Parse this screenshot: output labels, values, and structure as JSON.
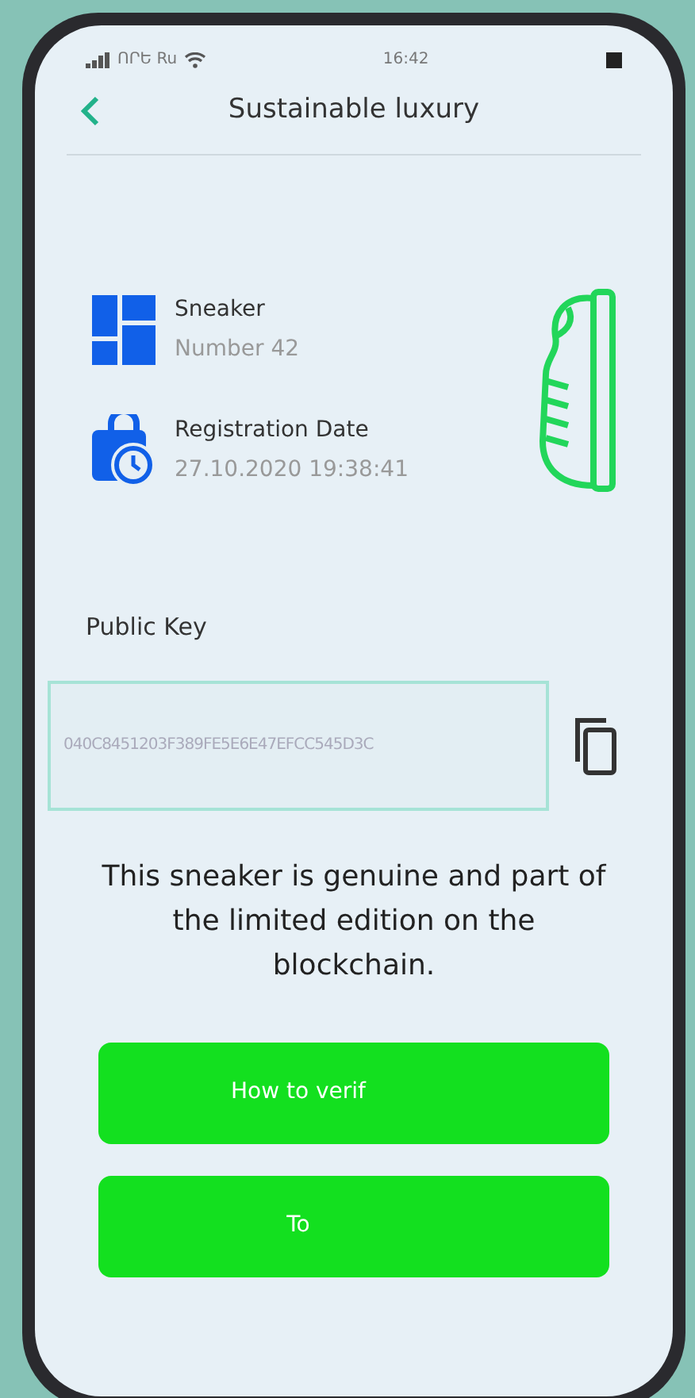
{
  "status_bar": {
    "carrier": "ՈՐԵ Ru",
    "time": "16:42"
  },
  "header": {
    "title": "Sustainable luxury"
  },
  "details": [
    {
      "kind": "product",
      "label": "Sneaker",
      "value": "Number 42"
    },
    {
      "kind": "date",
      "label": "Registration Date",
      "value": "27.10.2020 19:38:41"
    }
  ],
  "public_key": {
    "label": "Public Key",
    "value": "040C8451203F389FE5E6E47EFCC545D3C"
  },
  "message": "This sneaker is genuine and part of the limited edition on the blockchain.",
  "buttons": [
    {
      "label": "How to verif"
    },
    {
      "label": "To"
    }
  ]
}
